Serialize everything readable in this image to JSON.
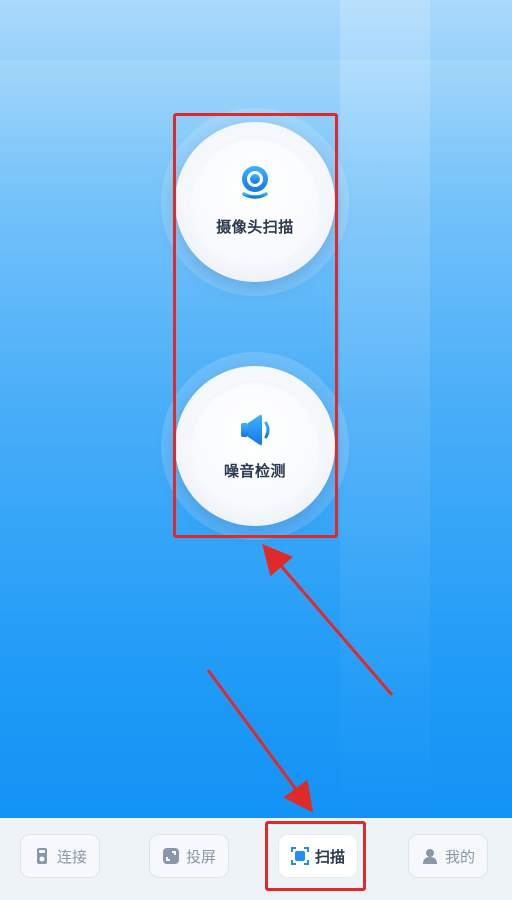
{
  "scan_options": [
    {
      "label": "摄像头扫描",
      "icon": "camera-icon"
    },
    {
      "label": "噪音检测",
      "icon": "speaker-icon"
    }
  ],
  "tabs": [
    {
      "label": "连接",
      "icon": "connect-icon",
      "active": false
    },
    {
      "label": "投屏",
      "icon": "cast-screen-icon",
      "active": false
    },
    {
      "label": "扫描",
      "icon": "scan-icon",
      "active": true
    },
    {
      "label": "我的",
      "icon": "user-icon",
      "active": false
    }
  ],
  "colors": {
    "accent": "#1f8ff5",
    "annotation_red": "#e02a2a",
    "label_dark": "#2b3a4f",
    "tab_inactive": "#8a97a8"
  }
}
